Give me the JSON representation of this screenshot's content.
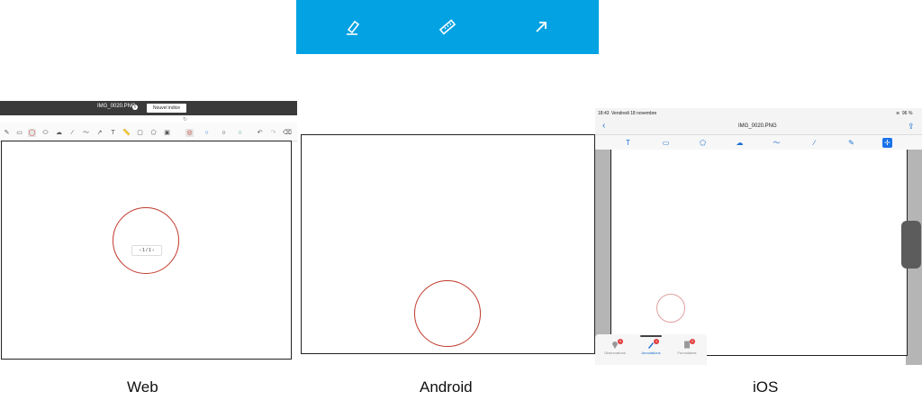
{
  "web": {
    "file_name": "IMG_0020.PNG",
    "info_icon": "i",
    "new_hint_button": "Nouvel indice",
    "pager": "1 / 1",
    "tools": [
      "pen-icon",
      "rectangle-icon",
      "circle-icon",
      "ellipse-icon",
      "cloud-icon",
      "line-icon",
      "polyline-icon",
      "arrow-icon",
      "text-icon",
      "ruler-icon",
      "comment-icon",
      "polygon-icon",
      "image-icon",
      "color-swatch-icon",
      "color-blue-icon",
      "color-black-icon",
      "color-green-icon",
      "undo-icon",
      "redo-icon",
      "eraser-icon"
    ]
  },
  "android": {
    "bar_color": "#03a2e3",
    "tools": [
      "highlighter-icon",
      "ruler-icon",
      "arrow-icon"
    ]
  },
  "ios": {
    "time": "18:43",
    "date": "Vendredi 18 novembre",
    "battery": "96 %",
    "file_name": "IMG_0020.PNG",
    "tools": [
      "text-icon",
      "rectangle-icon",
      "pentagon-icon",
      "cloud-icon",
      "polyline-icon",
      "ruler-icon",
      "highlighter-icon",
      "move-icon"
    ],
    "tabs": [
      {
        "label": "Observations",
        "badge": "0"
      },
      {
        "label": "Annotations",
        "badge": "1"
      },
      {
        "label": "Formulaires",
        "badge": "0"
      }
    ]
  },
  "captions": {
    "web": "Web",
    "android": "Android",
    "ios": "iOS"
  },
  "colors": {
    "annotation": "#c0392b",
    "ios_accent": "#1a73e8"
  }
}
